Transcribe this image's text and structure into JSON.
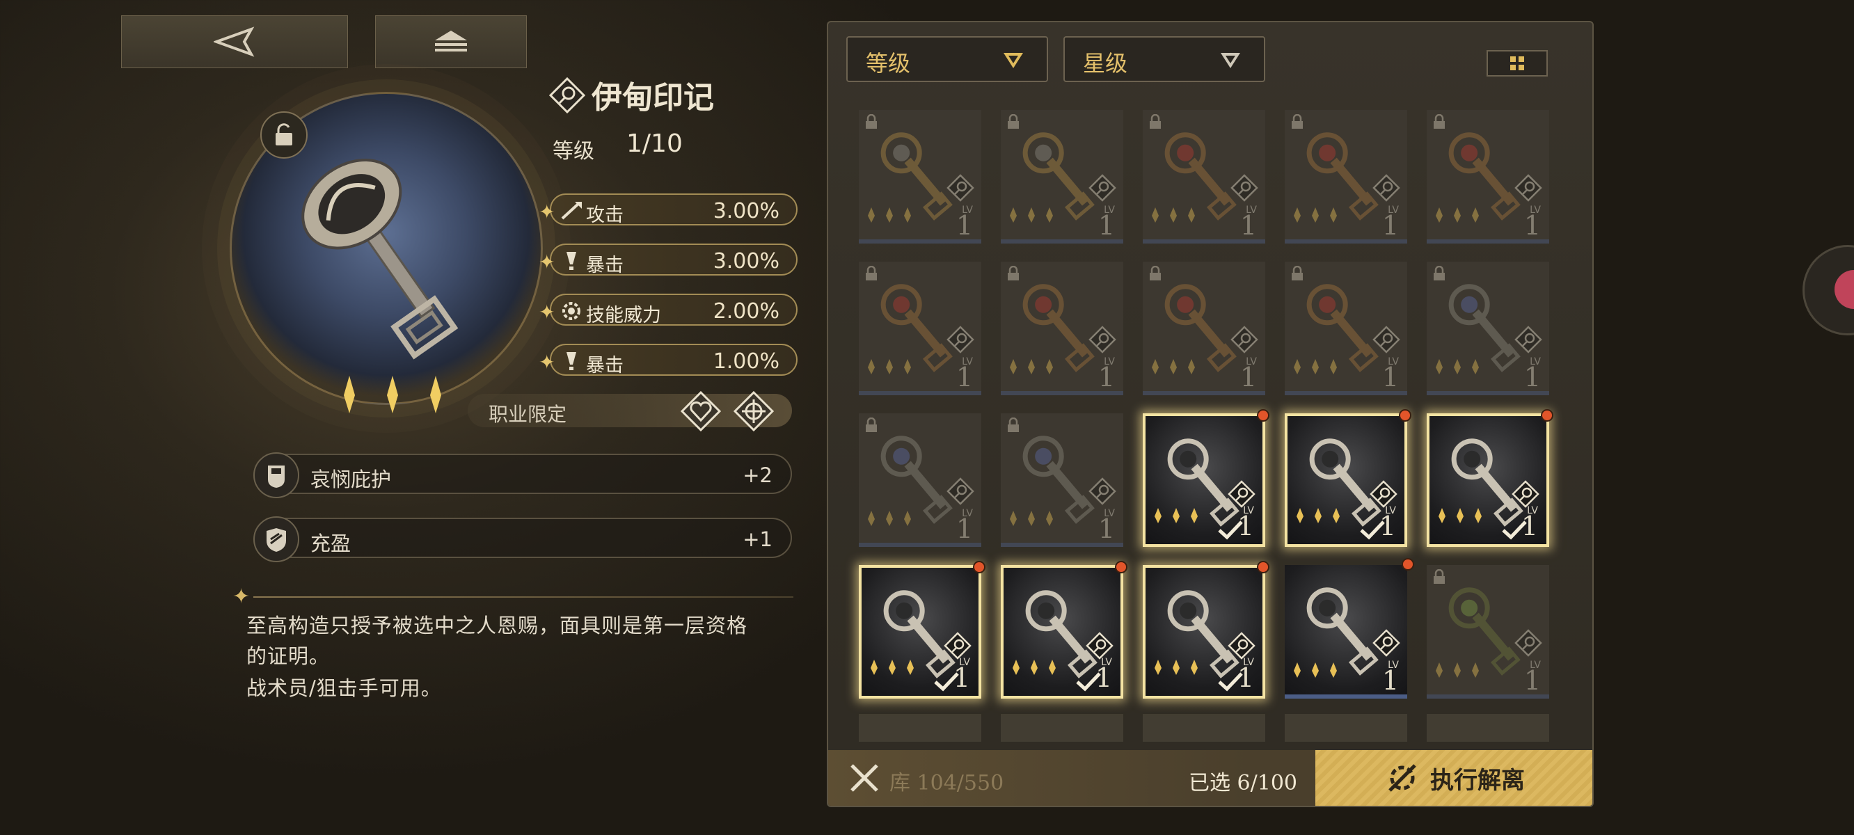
{
  "nav": {
    "back_icon": "back-arrow-icon",
    "home_icon": "stack-icon"
  },
  "item": {
    "name": "伊甸印记",
    "level_label": "等级",
    "level_value": "1/10",
    "star_count": 3,
    "stats": [
      {
        "label": "攻击",
        "value": "3.00%",
        "icon": "sword-icon"
      },
      {
        "label": "暴击",
        "value": "3.00%",
        "icon": "exclaim-icon"
      },
      {
        "label": "技能威力",
        "value": "2.00%",
        "icon": "gear-icon"
      },
      {
        "label": "暴击",
        "value": "1.00%",
        "icon": "exclaim-icon"
      }
    ],
    "class_restriction_label": "职业限定",
    "passives": [
      {
        "label": "哀悯庇护",
        "value": "+2",
        "icon": "shield-icon"
      },
      {
        "label": "充盈",
        "value": "+1",
        "icon": "crest-icon"
      }
    ],
    "description_lines": [
      "至高构造只授予被选中之人恩赐，面具则是第一层资格",
      "的证明。",
      "战术员/狙击手可用。"
    ]
  },
  "inventory": {
    "filters": [
      {
        "label": "等级"
      },
      {
        "label": "星级"
      }
    ],
    "cards": [
      {
        "state": "dim-locked",
        "type": "bronze-key",
        "lv": "1"
      },
      {
        "state": "dim-locked",
        "type": "bronze-key",
        "lv": "1"
      },
      {
        "state": "dim-locked",
        "type": "red-key",
        "lv": "1"
      },
      {
        "state": "dim-locked",
        "type": "red-key",
        "lv": "1"
      },
      {
        "state": "dim-locked",
        "type": "red-key",
        "lv": "1"
      },
      {
        "state": "dim-locked",
        "type": "red-key",
        "lv": "1"
      },
      {
        "state": "dim-locked",
        "type": "red-key",
        "lv": "1"
      },
      {
        "state": "dim-locked",
        "type": "red-key",
        "lv": "1"
      },
      {
        "state": "dim-locked",
        "type": "red-key",
        "lv": "1"
      },
      {
        "state": "dim-locked",
        "type": "blue-key",
        "lv": "1"
      },
      {
        "state": "dim-locked",
        "type": "blue-key",
        "lv": "1"
      },
      {
        "state": "dim-locked",
        "type": "blue-key",
        "lv": "1"
      },
      {
        "state": "selected",
        "type": "eden-key",
        "lv": "1"
      },
      {
        "state": "selected",
        "type": "eden-key",
        "lv": "1"
      },
      {
        "state": "selected",
        "type": "eden-key",
        "lv": "1"
      },
      {
        "state": "selected",
        "type": "eden-key",
        "lv": "1"
      },
      {
        "state": "selected",
        "type": "eden-key",
        "lv": "1"
      },
      {
        "state": "selected",
        "type": "eden-key",
        "lv": "1"
      },
      {
        "state": "owned",
        "type": "eden-key",
        "lv": "1"
      },
      {
        "state": "dim-locked",
        "type": "green-key",
        "lv": "1"
      }
    ],
    "footer": {
      "storage_text": "库 104/550",
      "selected_text": "已选 6/100",
      "dismantle_label": "执行解离"
    }
  },
  "colors": {
    "accent_gold": "#dcb860",
    "selection_glow": "#f4e3a2",
    "new_dot": "#e2552a"
  }
}
